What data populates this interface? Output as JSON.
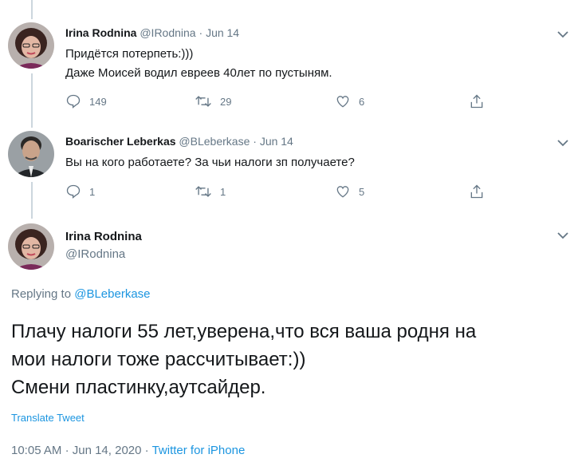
{
  "tweets": [
    {
      "name": "Irina Rodnina",
      "handle": "@IRodnina",
      "date": "Jun 14",
      "text_lines": [
        "Придётся потерпеть:)))",
        "Даже Моисей водил евреев 40лет по пустыням."
      ],
      "replies": "149",
      "retweets": "29",
      "likes": "6"
    },
    {
      "name": "Boarischer Leberkas",
      "handle": "@BLeberkase",
      "date": "Jun 14",
      "text_lines": [
        "Вы на кого работаете? За чьи налоги зп получаете?"
      ],
      "replies": "1",
      "retweets": "1",
      "likes": "5"
    }
  ],
  "main_tweet": {
    "name": "Irina Rodnina",
    "handle": "@IRodnina",
    "replying_prefix": "Replying to",
    "replying_to": "@BLeberkase",
    "text_lines": [
      "Плачу налоги 55 лет,уверена,что вся ваша родня на",
      "мои налоги тоже рассчитывает:))",
      "Смени пластинку,аутсайдер."
    ],
    "translate_label": "Translate Tweet",
    "time": "10:05 AM",
    "date": "Jun 14, 2020",
    "source": "Twitter for iPhone"
  },
  "icons": {
    "reply": "reply-icon",
    "retweet": "retweet-icon",
    "like": "heart-icon",
    "share": "share-icon",
    "more": "chevron-down-icon"
  },
  "colors": {
    "link": "#1b95e0",
    "secondary_text": "#657786",
    "thread_line": "#ccd6dd"
  }
}
